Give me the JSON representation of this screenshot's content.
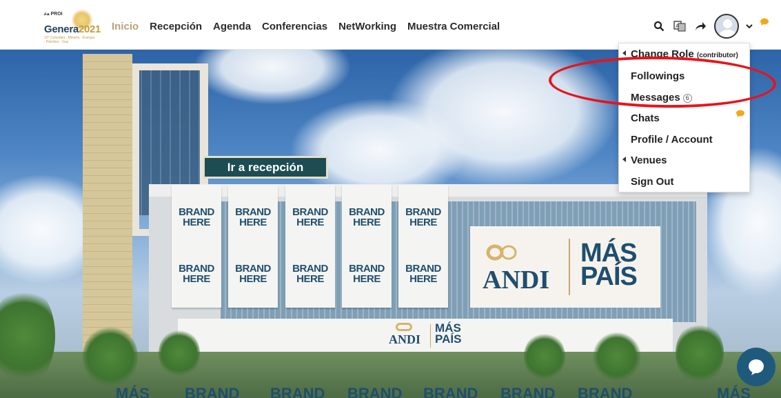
{
  "logo": {
    "line1": "ﻌﻋ PROI",
    "name": "Genera",
    "year": "2021",
    "tagline": "10° Colombia · Minería · Energía · Petróleo · Gas"
  },
  "nav": {
    "items": [
      "Inicio",
      "Recepción",
      "Agenda",
      "Conferencias",
      "NetWorking",
      "Muestra Comercial"
    ],
    "active": "Inicio"
  },
  "header_icons": [
    "search-icon",
    "translate-icon",
    "share-icon",
    "avatar",
    "chevron-down-icon",
    "chat-bubble-icon"
  ],
  "colors": {
    "active_nav": "#b9a27a",
    "cta_bg": "#1d4d52",
    "highlight": "#e8141a",
    "brand_blue": "#1f4e6e",
    "chat_fab": "#1f5a7c"
  },
  "hero": {
    "cta_label": "Ir a recepción",
    "banner_text": "BRAND\nHERE",
    "andi": "ANDI",
    "mas_pais": "MÁS\nPAÍS"
  },
  "menu": {
    "change_role": "Change Role",
    "role": "(contributor)",
    "followings": "Followings",
    "messages": "Messages",
    "messages_count": "6",
    "chats": "Chats",
    "profile": "Profile / Account",
    "venues": "Venues",
    "sign_out": "Sign Out"
  },
  "bottom_strip": [
    "MÁS",
    "BRAND",
    "BRAND",
    "BRAND",
    "BRAND",
    "BRAND",
    "BRAND",
    "MÁS"
  ]
}
